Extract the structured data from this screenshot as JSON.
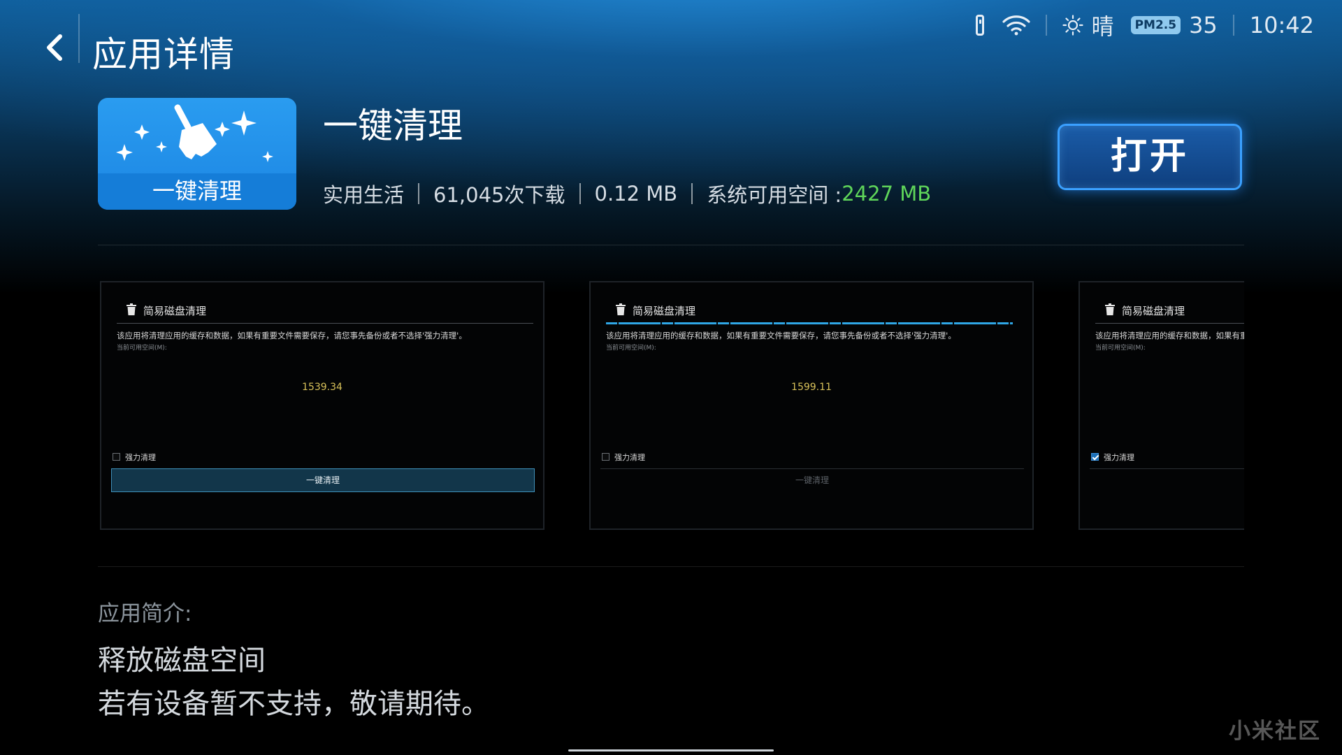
{
  "header": {
    "title": "应用详情"
  },
  "status_bar": {
    "weather": "晴",
    "pm_label": "PM2.5",
    "aqi": "35",
    "time": "10:42",
    "icons": [
      "remote-icon",
      "wifi-icon",
      "sun-icon"
    ]
  },
  "app": {
    "icon_label": "一键清理",
    "name": "一键清理",
    "category": "实用生活",
    "downloads": "61,045次下载",
    "size": "0.12 MB",
    "free_space_label": "系统可用空间 : ",
    "free_space_value": "2427 MB",
    "open_label": "打开",
    "accent_color": "#5fd65a"
  },
  "screenshots": [
    {
      "title": "简易磁盘清理",
      "desc": "该应用将清理应用的缓存和数据，如果有重要文件需要保存，请您事先备份或者不选择'强力清理'。",
      "sub": "当前可用空间(M):",
      "value": "1539.34",
      "checkbox_label": "强力清理",
      "checked": false,
      "button_label": "一键清理",
      "button_active": true,
      "progress": false
    },
    {
      "title": "简易磁盘清理",
      "desc": "该应用将清理应用的缓存和数据，如果有重要文件需要保存，请您事先备份或者不选择'强力清理'。",
      "sub": "当前可用空间(M):",
      "value": "1599.11",
      "checkbox_label": "强力清理",
      "checked": false,
      "button_label": "一键清理",
      "button_active": false,
      "progress": true
    },
    {
      "title": "简易磁盘清理",
      "desc": "该应用将清理应用的缓存和数据，如果有重要文件需要保存，请您事先备份或者不选择'强力清理'。",
      "sub": "当前可用空间(M):",
      "value": "",
      "checkbox_label": "强力清理",
      "checked": true,
      "button_label": "",
      "button_active": false,
      "progress": false
    }
  ],
  "description": {
    "label": "应用简介:",
    "lines": [
      "释放磁盘空间",
      "若有设备暂不支持，敬请期待。"
    ]
  },
  "watermark": "小米社区"
}
